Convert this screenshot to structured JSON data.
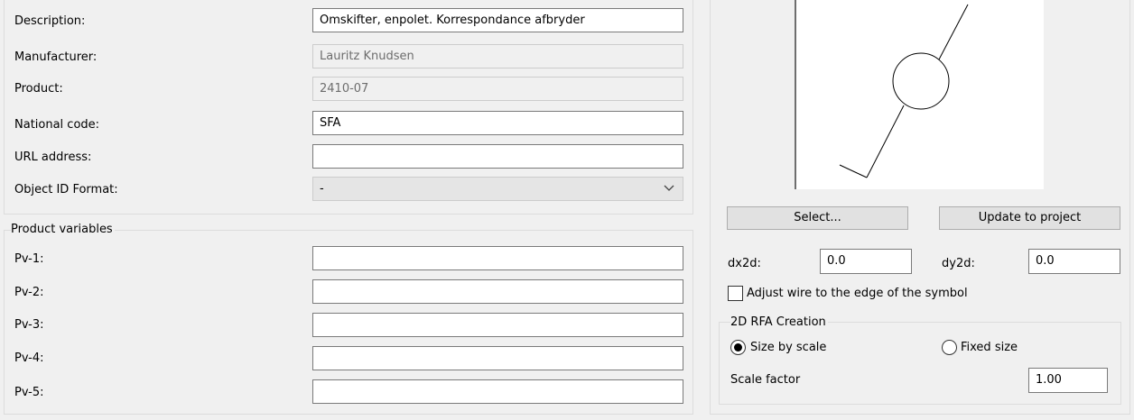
{
  "properties": {
    "description_label": "Description:",
    "description_value": "Omskifter, enpolet. Korrespondance afbryder",
    "manufacturer_label": "Manufacturer:",
    "manufacturer_value": "Lauritz Knudsen",
    "product_label": "Product:",
    "product_value": "2410-07",
    "national_code_label": "National code:",
    "national_code_value": "SFA",
    "url_label": "URL address:",
    "url_value": "",
    "object_id_label": "Object ID Format:",
    "object_id_value": "-"
  },
  "product_variables": {
    "title": "Product variables",
    "items": [
      {
        "label": "Pv-1:",
        "value": ""
      },
      {
        "label": "Pv-2:",
        "value": ""
      },
      {
        "label": "Pv-3:",
        "value": ""
      },
      {
        "label": "Pv-4:",
        "value": ""
      },
      {
        "label": "Pv-5:",
        "value": ""
      }
    ]
  },
  "symbol": {
    "select_label": "Select...",
    "update_label": "Update to project",
    "dx_label": "dx2d:",
    "dx_value": "0.0",
    "dy_label": "dy2d:",
    "dy_value": "0.0",
    "adjust_wire_label": "Adjust wire to the edge of the symbol",
    "adjust_wire_checked": false
  },
  "rfa_creation": {
    "title": "2D RFA Creation",
    "size_by_scale_label": "Size by scale",
    "fixed_size_label": "Fixed size",
    "selected": "size_by_scale",
    "scale_factor_label": "Scale factor",
    "scale_factor_value": "1.00"
  }
}
